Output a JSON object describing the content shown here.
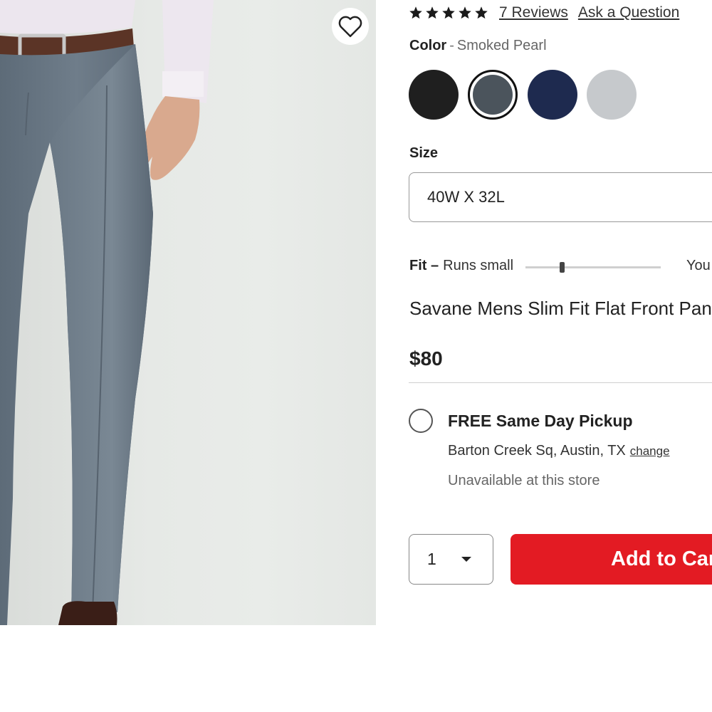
{
  "product": {
    "title": "Savane Mens Slim Fit Flat Front Pants",
    "price": "$80",
    "rating": 5
  },
  "reviews": {
    "count_label": "7 Reviews",
    "ask_label": "Ask a Question"
  },
  "color": {
    "label": "Color",
    "separator": "-",
    "selected": "Smoked Pearl",
    "swatches": [
      {
        "name": "Black",
        "hex": "#1f1f1f"
      },
      {
        "name": "Smoked Pearl",
        "hex": "#4b545c"
      },
      {
        "name": "Navy",
        "hex": "#1e2a4f"
      },
      {
        "name": "Light Grey",
        "hex": "#c6c9cc"
      }
    ]
  },
  "size": {
    "label": "Size",
    "selected": "40W X 32L"
  },
  "fit": {
    "label": "Fit –",
    "value": "Runs small",
    "true_label": "You",
    "slider_level": 0.27
  },
  "pickup": {
    "title": "FREE Same Day Pickup",
    "store": "Barton Creek Sq, Austin, TX",
    "change_label": "change",
    "availability": "Unavailable at this store"
  },
  "cart": {
    "quantity": "1",
    "add_label": "Add to Cart"
  },
  "colors": {
    "accent": "#e31b23"
  },
  "icons": {
    "wishlist": "heart-icon",
    "star": "star-icon",
    "dropdown": "caret-down-icon"
  }
}
